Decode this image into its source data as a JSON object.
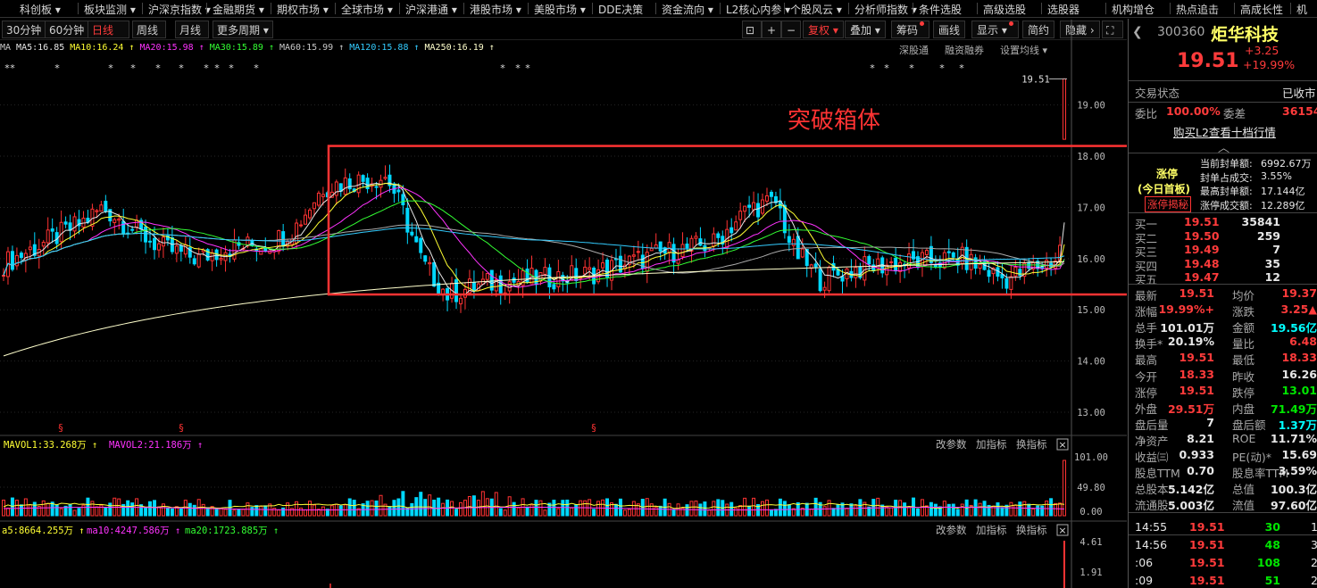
{
  "nav": [
    "科创板",
    "板块监测",
    "沪深京指数",
    "金融期货",
    "期权市场",
    "全球市场",
    "沪深港通",
    "港股市场",
    "美股市场",
    "DDE决策",
    "资金流向",
    "L2核心内参",
    "个股风云",
    "分析师指数",
    "条件选股",
    "高级选股",
    "选股器",
    "机构增仓",
    "热点追击",
    "高成长性",
    "机"
  ],
  "periods": [
    "30分钟",
    "60分钟",
    "日线",
    "周线",
    "月线",
    "更多周期"
  ],
  "toolbar_right": {
    "fuquan": "复权",
    "diejia": "叠加",
    "chouma": "筹码",
    "huaxian": "画线",
    "xianshi": "显示",
    "jianyue": "简约",
    "yincang": "隐藏"
  },
  "ma_labels": [
    {
      "text": "MA",
      "color": "#c8c8c8"
    },
    {
      "text": "MA5:16.85",
      "color": "#e6e6e6"
    },
    {
      "text": "MA10:16.24 ↑",
      "color": "#ffff33"
    },
    {
      "text": "MA20:15.98 ↑",
      "color": "#ff33ff"
    },
    {
      "text": "MA30:15.89 ↑",
      "color": "#33ff33"
    },
    {
      "text": "MA60:15.99 ↑",
      "color": "#c8c8c8"
    },
    {
      "text": "MA120:15.88 ↑",
      "color": "#33ccff"
    },
    {
      "text": "MA250:16.19 ↑",
      "color": "#ffffcc"
    }
  ],
  "ma_right": [
    "深股通",
    "融资融券",
    "设置均线"
  ],
  "price_axis": [
    "19.00",
    "18.00",
    "17.00",
    "16.00",
    "15.00",
    "14.00",
    "13.00"
  ],
  "last_price_tag": "19.51",
  "annotation": "突破箱体",
  "vol_labels": [
    {
      "text": "MAVOL1:33.268万 ↑",
      "color": "#ffff33"
    },
    {
      "text": "MAVOL2:21.186万 ↑",
      "color": "#ff33ff"
    }
  ],
  "vol_axis": [
    "101.00",
    "49.80",
    "0.00"
  ],
  "panel_buttons": [
    "改参数",
    "加指标",
    "换指标"
  ],
  "macd_labels": [
    {
      "text": "a5:8664.255万 ↑",
      "color": "#ffff33"
    },
    {
      "text": "ma10:4247.586万 ↑",
      "color": "#ff33ff"
    },
    {
      "text": "ma20:1723.885万 ↑",
      "color": "#33ff33"
    }
  ],
  "macd_axis": [
    "4.61",
    "1.91"
  ],
  "stock": {
    "code": "300360",
    "name": "炬华科技",
    "price": "19.51",
    "chg": "+3.25",
    "pct": "+19.99%",
    "status_label": "交易状态",
    "status": "已收市",
    "weibi_label": "委比",
    "weibi": "100.00%",
    "weicha_label": "委差",
    "weicha": "36154",
    "l2_link": "购买L2查看十档行情",
    "limit_title": "涨停",
    "limit_sub": "(今日首板)",
    "limit_btn": "涨停揭秘",
    "seal": [
      {
        "k": "当前封单额:",
        "v": "6992.67万"
      },
      {
        "k": "封单占成交:",
        "v": "3.55%"
      },
      {
        "k": "最高封单额:",
        "v": "17.144亿"
      },
      {
        "k": "涨停成交额:",
        "v": "12.289亿"
      }
    ],
    "bids": [
      {
        "k": "买一",
        "p": "19.51",
        "v": "35841"
      },
      {
        "k": "买二",
        "p": "19.50",
        "v": "259"
      },
      {
        "k": "买三",
        "p": "19.49",
        "v": "7"
      },
      {
        "k": "买四",
        "p": "19.48",
        "v": "35"
      },
      {
        "k": "买五",
        "p": "19.47",
        "v": "12"
      }
    ],
    "stats": [
      {
        "k1": "最新",
        "v1": "19.51",
        "c1": "red",
        "k2": "均价",
        "v2": "19.37",
        "c2": "red"
      },
      {
        "k1": "涨幅",
        "v1": "+19.99%",
        "c1": "red",
        "k2": "涨跌",
        "v2": "▲3.25",
        "c2": "red"
      },
      {
        "k1": "总手",
        "v1": "101.01万",
        "c1": "white",
        "k2": "金额",
        "v2": "19.56亿",
        "c2": "cyan"
      },
      {
        "k1": "换手*",
        "v1": "20.19%",
        "c1": "white",
        "k2": "量比",
        "v2": "6.48",
        "c2": "red"
      },
      {
        "k1": "最高",
        "v1": "19.51",
        "c1": "red",
        "k2": "最低",
        "v2": "18.33",
        "c2": "red"
      },
      {
        "k1": "今开",
        "v1": "18.33",
        "c1": "red",
        "k2": "昨收",
        "v2": "16.26",
        "c2": "white"
      },
      {
        "k1": "涨停",
        "v1": "19.51",
        "c1": "red",
        "k2": "跌停",
        "v2": "13.01",
        "c2": "green"
      },
      {
        "k1": "外盘",
        "v1": "29.51万",
        "c1": "red",
        "k2": "内盘",
        "v2": "71.49万",
        "c2": "green"
      },
      {
        "k1": "盘后量",
        "v1": "7",
        "c1": "white",
        "k2": "盘后额",
        "v2": "1.37万",
        "c2": "cyan"
      },
      {
        "k1": "净资产",
        "v1": "8.21",
        "c1": "white",
        "k2": "ROE",
        "v2": "11.71%",
        "c2": "white"
      },
      {
        "k1": "收益㈢",
        "v1": "0.933",
        "c1": "white",
        "k2": "PE(动)*",
        "v2": "15.69",
        "c2": "white"
      },
      {
        "k1": "股息TTM",
        "v1": "0.70",
        "c1": "white",
        "k2": "股息率TTM",
        "v2": "3.59%",
        "c2": "white"
      },
      {
        "k1": "总股本",
        "v1": "5.142亿",
        "c1": "white",
        "k2": "总值",
        "v2": "100.3亿",
        "c2": "white"
      },
      {
        "k1": "流通股",
        "v1": "5.003亿",
        "c1": "white",
        "k2": "流值",
        "v2": "97.60亿",
        "c2": "white"
      }
    ],
    "ticks": [
      {
        "t": "14:55",
        "p": "19.51",
        "v": "30",
        "n": "1"
      },
      {
        "t": "14:56",
        "p": "19.51",
        "v": "48",
        "n": "3"
      },
      {
        "t": ":06",
        "p": "19.51",
        "v": "108",
        "n": "2"
      },
      {
        "t": ":09",
        "p": "19.51",
        "v": "51",
        "n": "2"
      }
    ]
  },
  "chart_data": {
    "type": "candlestick",
    "title": "",
    "ylim": [
      12.6,
      19.9
    ],
    "highlight_box": {
      "label": "突破箱体",
      "y_range": [
        15.3,
        18.2
      ]
    },
    "last": 19.51
  }
}
